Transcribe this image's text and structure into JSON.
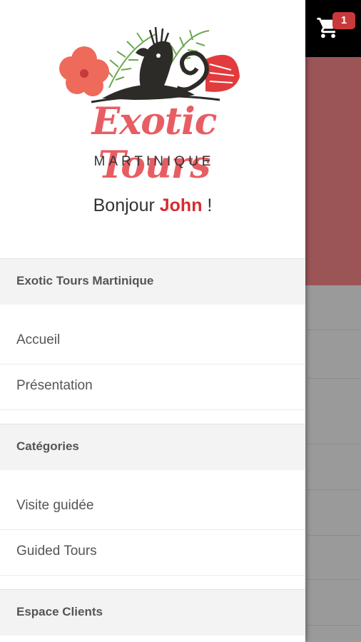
{
  "header": {
    "cart_badge": "1",
    "cart_icon": "shopping-cart-icon"
  },
  "drawer": {
    "logo": {
      "title": "Exotic Tours",
      "subtitle": "MARTINIQUE"
    },
    "greeting": {
      "prefix": "Bonjour ",
      "name": "John",
      "suffix": " !"
    },
    "sections": [
      {
        "title": "Exotic Tours Martinique",
        "items": [
          {
            "label": "Accueil"
          },
          {
            "label": "Présentation"
          }
        ]
      },
      {
        "title": "Catégories",
        "items": [
          {
            "label": "Visite guidée"
          },
          {
            "label": "Guided Tours"
          }
        ]
      },
      {
        "title": "Espace Clients",
        "items": []
      }
    ]
  },
  "colors": {
    "brand_red": "#e85d63",
    "accent_red": "#d62d32",
    "topbar": "#000000",
    "banner_dimmed": "#9c5557"
  }
}
